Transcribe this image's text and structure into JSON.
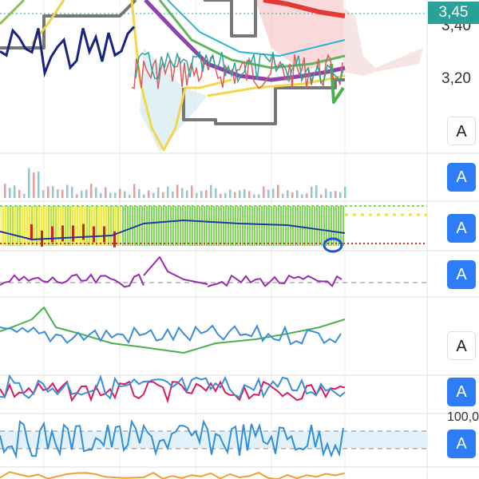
{
  "price_axis": {
    "label_upper": "3,40",
    "label_lower": "3,20",
    "current_price": "3,45",
    "oscillator_top": "100,0"
  },
  "buttons": [
    "A",
    "A",
    "A",
    "A",
    "A",
    "A",
    "A"
  ],
  "colors": {
    "accent_button": "#2f7df6",
    "price_badge": "#2aa198",
    "grid": "#e6e6e6",
    "separator": "#dcdcdc"
  }
}
